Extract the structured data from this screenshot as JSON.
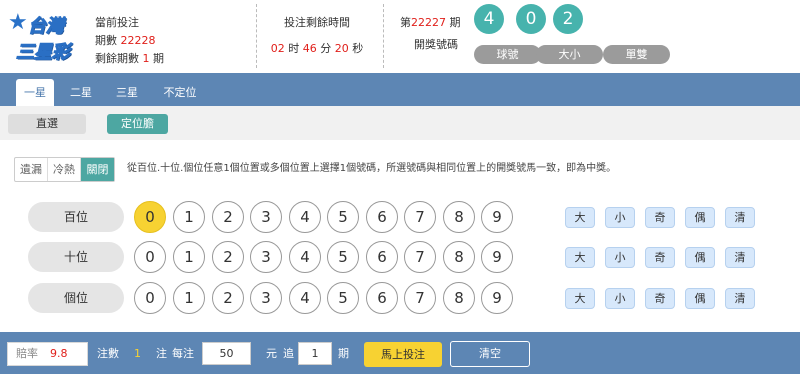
{
  "logo": {
    "line1": "台灣",
    "line2": "三星彩"
  },
  "current_bet": {
    "title": "當前投注",
    "period_label": "期數",
    "period": "22228",
    "remaining_label": "剩餘期數",
    "remaining": "1",
    "remaining_unit": "期"
  },
  "countdown": {
    "title": "投注剩餘時間",
    "hours": "02",
    "h_unit": "时",
    "minutes": "46",
    "m_unit": "分",
    "seconds": "20",
    "s_unit": "秒"
  },
  "draw": {
    "prefix": "第",
    "period": "22227",
    "suffix": "期",
    "label": "開獎號碼",
    "balls": [
      "4",
      "0",
      "2"
    ],
    "tabs": [
      "球號",
      "大小",
      "單雙"
    ]
  },
  "nav": {
    "tabs": [
      "一星",
      "二星",
      "三星",
      "不定位"
    ],
    "active": 0
  },
  "subnav": {
    "tabs": [
      "直選",
      "定位膽"
    ],
    "active": 1
  },
  "toggle": {
    "options": [
      "遺漏",
      "冷熱",
      "關閉"
    ],
    "active": 2
  },
  "hint": "從百位.十位.個位任意1個位置或多個位置上選擇1個號碼，所選號碼與相同位置上的開獎號馬一致，即為中獎。",
  "rows": [
    {
      "label": "百位",
      "selected": [
        0
      ]
    },
    {
      "label": "十位",
      "selected": []
    },
    {
      "label": "個位",
      "selected": []
    }
  ],
  "numbers": [
    "0",
    "1",
    "2",
    "3",
    "4",
    "5",
    "6",
    "7",
    "8",
    "9"
  ],
  "quick_picks": [
    "大",
    "小",
    "奇",
    "偶",
    "清"
  ],
  "footer": {
    "odds_label": "賠率",
    "odds": "9.8",
    "count_label": "注數",
    "count": "1",
    "count_unit": "注",
    "per_label": "每注",
    "per_value": "50",
    "yuan": "元",
    "chase_label": "追",
    "chase_value": "1",
    "chase_unit": "期",
    "bet_button": "馬上投注",
    "clear_button": "清空"
  },
  "colors": {
    "nav": "#5d86b4",
    "teal": "#47b3ad",
    "red": "#e0201b",
    "yellow": "#f7d232"
  }
}
